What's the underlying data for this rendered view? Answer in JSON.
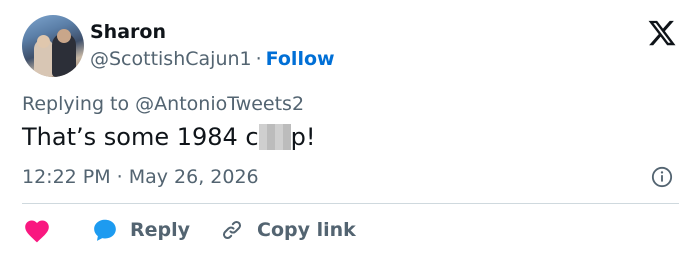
{
  "author": {
    "name": "Sharon",
    "handle": "@ScottishCajun1",
    "separator": "·",
    "follow_label": "Follow"
  },
  "reply_context": {
    "prefix": "Replying to",
    "mention": "@AntonioTweets2"
  },
  "tweet": {
    "text_before": "That’s some 1984 c",
    "text_after": "p!"
  },
  "meta": {
    "time": "12:22 PM",
    "separator": "·",
    "date": "May 26, 2026"
  },
  "actions": {
    "reply_label": "Reply",
    "copy_link_label": "Copy link"
  },
  "icons": {
    "logo": "x-logo-icon",
    "info": "info-icon",
    "like": "heart-icon",
    "reply": "speech-bubble-icon",
    "copy": "link-icon"
  },
  "colors": {
    "like": "#f91880",
    "reply": "#1d9bf0",
    "follow": "#006fd6",
    "secondary_text": "#536471"
  }
}
